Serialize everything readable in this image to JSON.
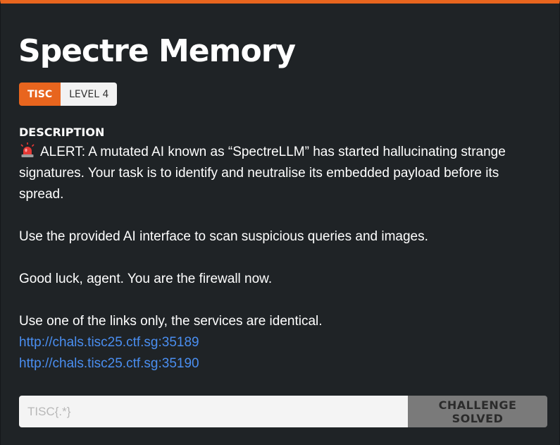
{
  "challenge": {
    "title": "Spectre Memory",
    "tags": {
      "event": "TISC",
      "level": "LEVEL 4"
    },
    "description_heading": "DESCRIPTION",
    "description": {
      "alert_icon": "rotating-light-icon",
      "alert_text": "ALERT: A mutated AI known as “SpectreLLM” has started hallucinating strange signatures. Your task is to identify and neutralise its embedded payload before its spread.",
      "paragraph_2": "Use the provided AI interface to scan suspicious queries and images.",
      "paragraph_3": "Good luck, agent. You are the firewall now.",
      "paragraph_4": "Use one of the links only, the services are identical.",
      "links": [
        "http://chals.tisc25.ctf.sg:35189",
        "http://chals.tisc25.ctf.sg:35190"
      ]
    },
    "flag_form": {
      "placeholder": "TISC{.*}",
      "value": "",
      "button_label": "CHALLENGE SOLVED",
      "button_state": "disabled"
    }
  },
  "colors": {
    "accent": "#e8651e",
    "background": "#1f2326",
    "link": "#4a8ef0",
    "button_disabled": "#7a7a7a"
  }
}
